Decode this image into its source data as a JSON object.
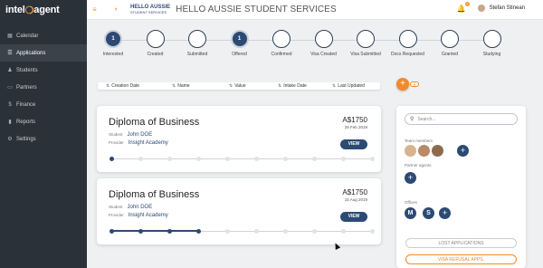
{
  "logo": {
    "text_a": "intel",
    "text_b": "agent",
    "bulb": "❍"
  },
  "sidebar": {
    "items": [
      {
        "label": "Calendar",
        "icon": "▦"
      },
      {
        "label": "Applications",
        "icon": "☰"
      },
      {
        "label": "Students",
        "icon": "♟"
      },
      {
        "label": "Partners",
        "icon": "▭"
      },
      {
        "label": "Finance",
        "icon": "$"
      },
      {
        "label": "Reports",
        "icon": "▮"
      },
      {
        "label": "Settings",
        "icon": "⚙"
      }
    ]
  },
  "header": {
    "menu_icon": "≡",
    "brand_line1": "HELLO AUSSIE",
    "brand_line2": "STUDENT SERVICES",
    "brand_icon": "◗",
    "title": "HELLO AUSSIE STUDENT SERVICES",
    "bell_icon": "🔔",
    "notif_count": "1",
    "user_name": "Stefan Stinean"
  },
  "stepper": {
    "steps": [
      {
        "label": "Interested",
        "num": "1"
      },
      {
        "label": "Created",
        "num": ""
      },
      {
        "label": "Submitted",
        "num": ""
      },
      {
        "label": "Offered",
        "num": "1"
      },
      {
        "label": "Confirmed",
        "num": ""
      },
      {
        "label": "Visa Created",
        "num": ""
      },
      {
        "label": "Visa Submitted",
        "num": ""
      },
      {
        "label": "Docs Requested",
        "num": ""
      },
      {
        "label": "Granted",
        "num": ""
      },
      {
        "label": "Studying",
        "num": ""
      }
    ]
  },
  "sort": {
    "arrow": "⇅",
    "columns": [
      "Creation Date",
      "Name",
      "Value",
      "Intake Date",
      "Last Updated"
    ]
  },
  "add_button": {
    "label": "+",
    "dropdown": "▾"
  },
  "cards": [
    {
      "title": "Diploma of Business",
      "price": "A$1750",
      "date": "28 Feb 2019",
      "student_label": "Student",
      "student": "John DOE",
      "provider_label": "Provider",
      "provider": "Insight Academy",
      "view_label": "VIEW",
      "progress_steps_done": 1,
      "progress_steps_total": 10
    },
    {
      "title": "Diploma of Business",
      "price": "A$1750",
      "date": "15 Aug 2019",
      "student_label": "Student",
      "student": "John DOE",
      "provider_label": "Provider",
      "provider": "Insight Academy",
      "view_label": "VIEW",
      "progress_steps_done": 4,
      "progress_steps_total": 10
    }
  ],
  "panel": {
    "search_placeholder": "Search...",
    "search_icon": "⚲",
    "team_label": "Team members",
    "partner_label": "Partner agents",
    "offices_label": "Offices",
    "offices": [
      "M",
      "S"
    ],
    "plus": "+",
    "lost_label": "LOST APPLICATIONS",
    "visa_label": "VISA REFUSAL APPS."
  },
  "colors": {
    "accent": "#f2892c",
    "navy": "#2c4a73",
    "sidebar": "#2b3138"
  }
}
